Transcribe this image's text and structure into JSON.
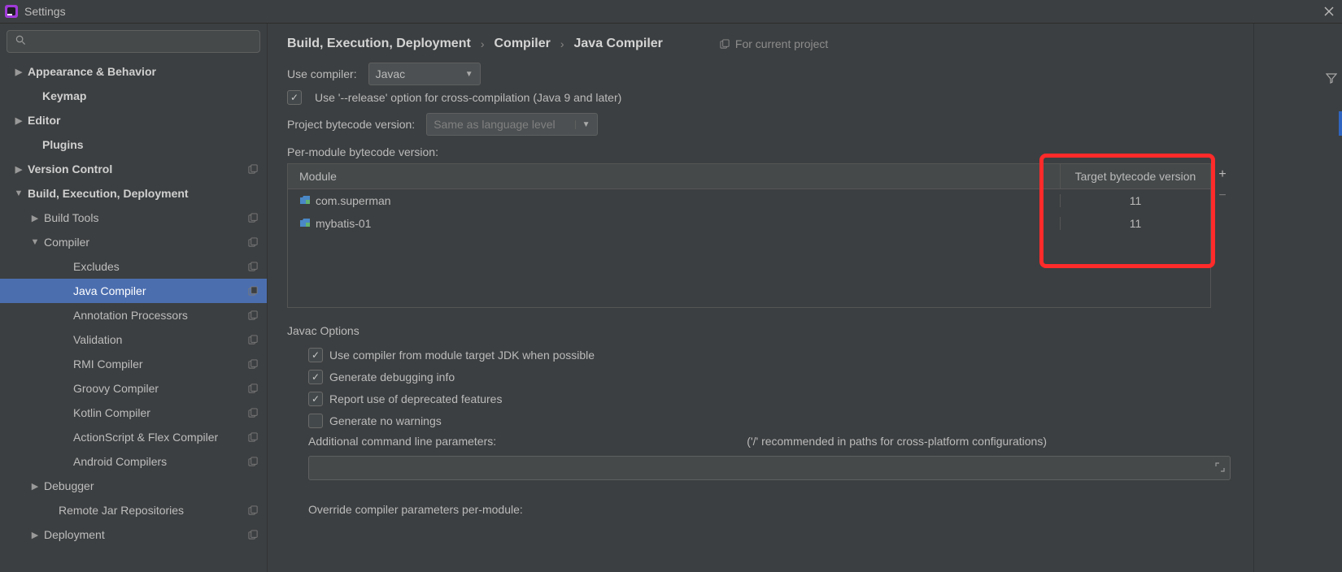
{
  "window": {
    "title": "Settings"
  },
  "search": {
    "placeholder": ""
  },
  "sidebar": {
    "items": [
      {
        "label": "Appearance & Behavior",
        "bold": true,
        "arrow": "▶",
        "indent": 16,
        "proj": false
      },
      {
        "label": "Keymap",
        "bold": true,
        "arrow": "",
        "indent": 34,
        "proj": false
      },
      {
        "label": "Editor",
        "bold": true,
        "arrow": "▶",
        "indent": 16,
        "proj": false
      },
      {
        "label": "Plugins",
        "bold": true,
        "arrow": "",
        "indent": 34,
        "proj": false
      },
      {
        "label": "Version Control",
        "bold": true,
        "arrow": "▶",
        "indent": 16,
        "proj": true
      },
      {
        "label": "Build, Execution, Deployment",
        "bold": true,
        "arrow": "▼",
        "indent": 16,
        "proj": false
      },
      {
        "label": "Build Tools",
        "bold": false,
        "arrow": "▶",
        "indent": 36,
        "proj": true
      },
      {
        "label": "Compiler",
        "bold": false,
        "arrow": "▼",
        "indent": 36,
        "proj": true
      },
      {
        "label": "Excludes",
        "bold": false,
        "arrow": "",
        "indent": 72,
        "proj": true
      },
      {
        "label": "Java Compiler",
        "bold": false,
        "arrow": "",
        "indent": 72,
        "proj": true,
        "selected": true
      },
      {
        "label": "Annotation Processors",
        "bold": false,
        "arrow": "",
        "indent": 72,
        "proj": true
      },
      {
        "label": "Validation",
        "bold": false,
        "arrow": "",
        "indent": 72,
        "proj": true
      },
      {
        "label": "RMI Compiler",
        "bold": false,
        "arrow": "",
        "indent": 72,
        "proj": true
      },
      {
        "label": "Groovy Compiler",
        "bold": false,
        "arrow": "",
        "indent": 72,
        "proj": true
      },
      {
        "label": "Kotlin Compiler",
        "bold": false,
        "arrow": "",
        "indent": 72,
        "proj": true
      },
      {
        "label": "ActionScript & Flex Compiler",
        "bold": false,
        "arrow": "",
        "indent": 72,
        "proj": true
      },
      {
        "label": "Android Compilers",
        "bold": false,
        "arrow": "",
        "indent": 72,
        "proj": true
      },
      {
        "label": "Debugger",
        "bold": false,
        "arrow": "▶",
        "indent": 36,
        "proj": false
      },
      {
        "label": "Remote Jar Repositories",
        "bold": false,
        "arrow": "",
        "indent": 54,
        "proj": true
      },
      {
        "label": "Deployment",
        "bold": false,
        "arrow": "▶",
        "indent": 36,
        "proj": true
      }
    ]
  },
  "breadcrumb": {
    "a": "Build, Execution, Deployment",
    "b": "Compiler",
    "c": "Java Compiler",
    "hint": "For current project"
  },
  "form": {
    "use_compiler_label": "Use compiler:",
    "compiler_value": "Javac",
    "release_option": "Use '--release' option for cross-compilation (Java 9 and later)",
    "project_bytecode_label": "Project bytecode version:",
    "project_bytecode_placeholder": "Same as language level",
    "per_module_label": "Per-module bytecode version:"
  },
  "table": {
    "header_module": "Module",
    "header_target": "Target bytecode version",
    "rows": [
      {
        "module": "com.superman",
        "target": "11"
      },
      {
        "module": "mybatis-01",
        "target": "11"
      }
    ]
  },
  "javac": {
    "title": "Javac Options",
    "opt1": "Use compiler from module target JDK when possible",
    "opt2": "Generate debugging info",
    "opt3": "Report use of deprecated features",
    "opt4": "Generate no warnings",
    "params_label": "Additional command line parameters:",
    "params_hint": "('/' recommended in paths for cross-platform configurations)",
    "override": "Override compiler parameters per-module:"
  }
}
